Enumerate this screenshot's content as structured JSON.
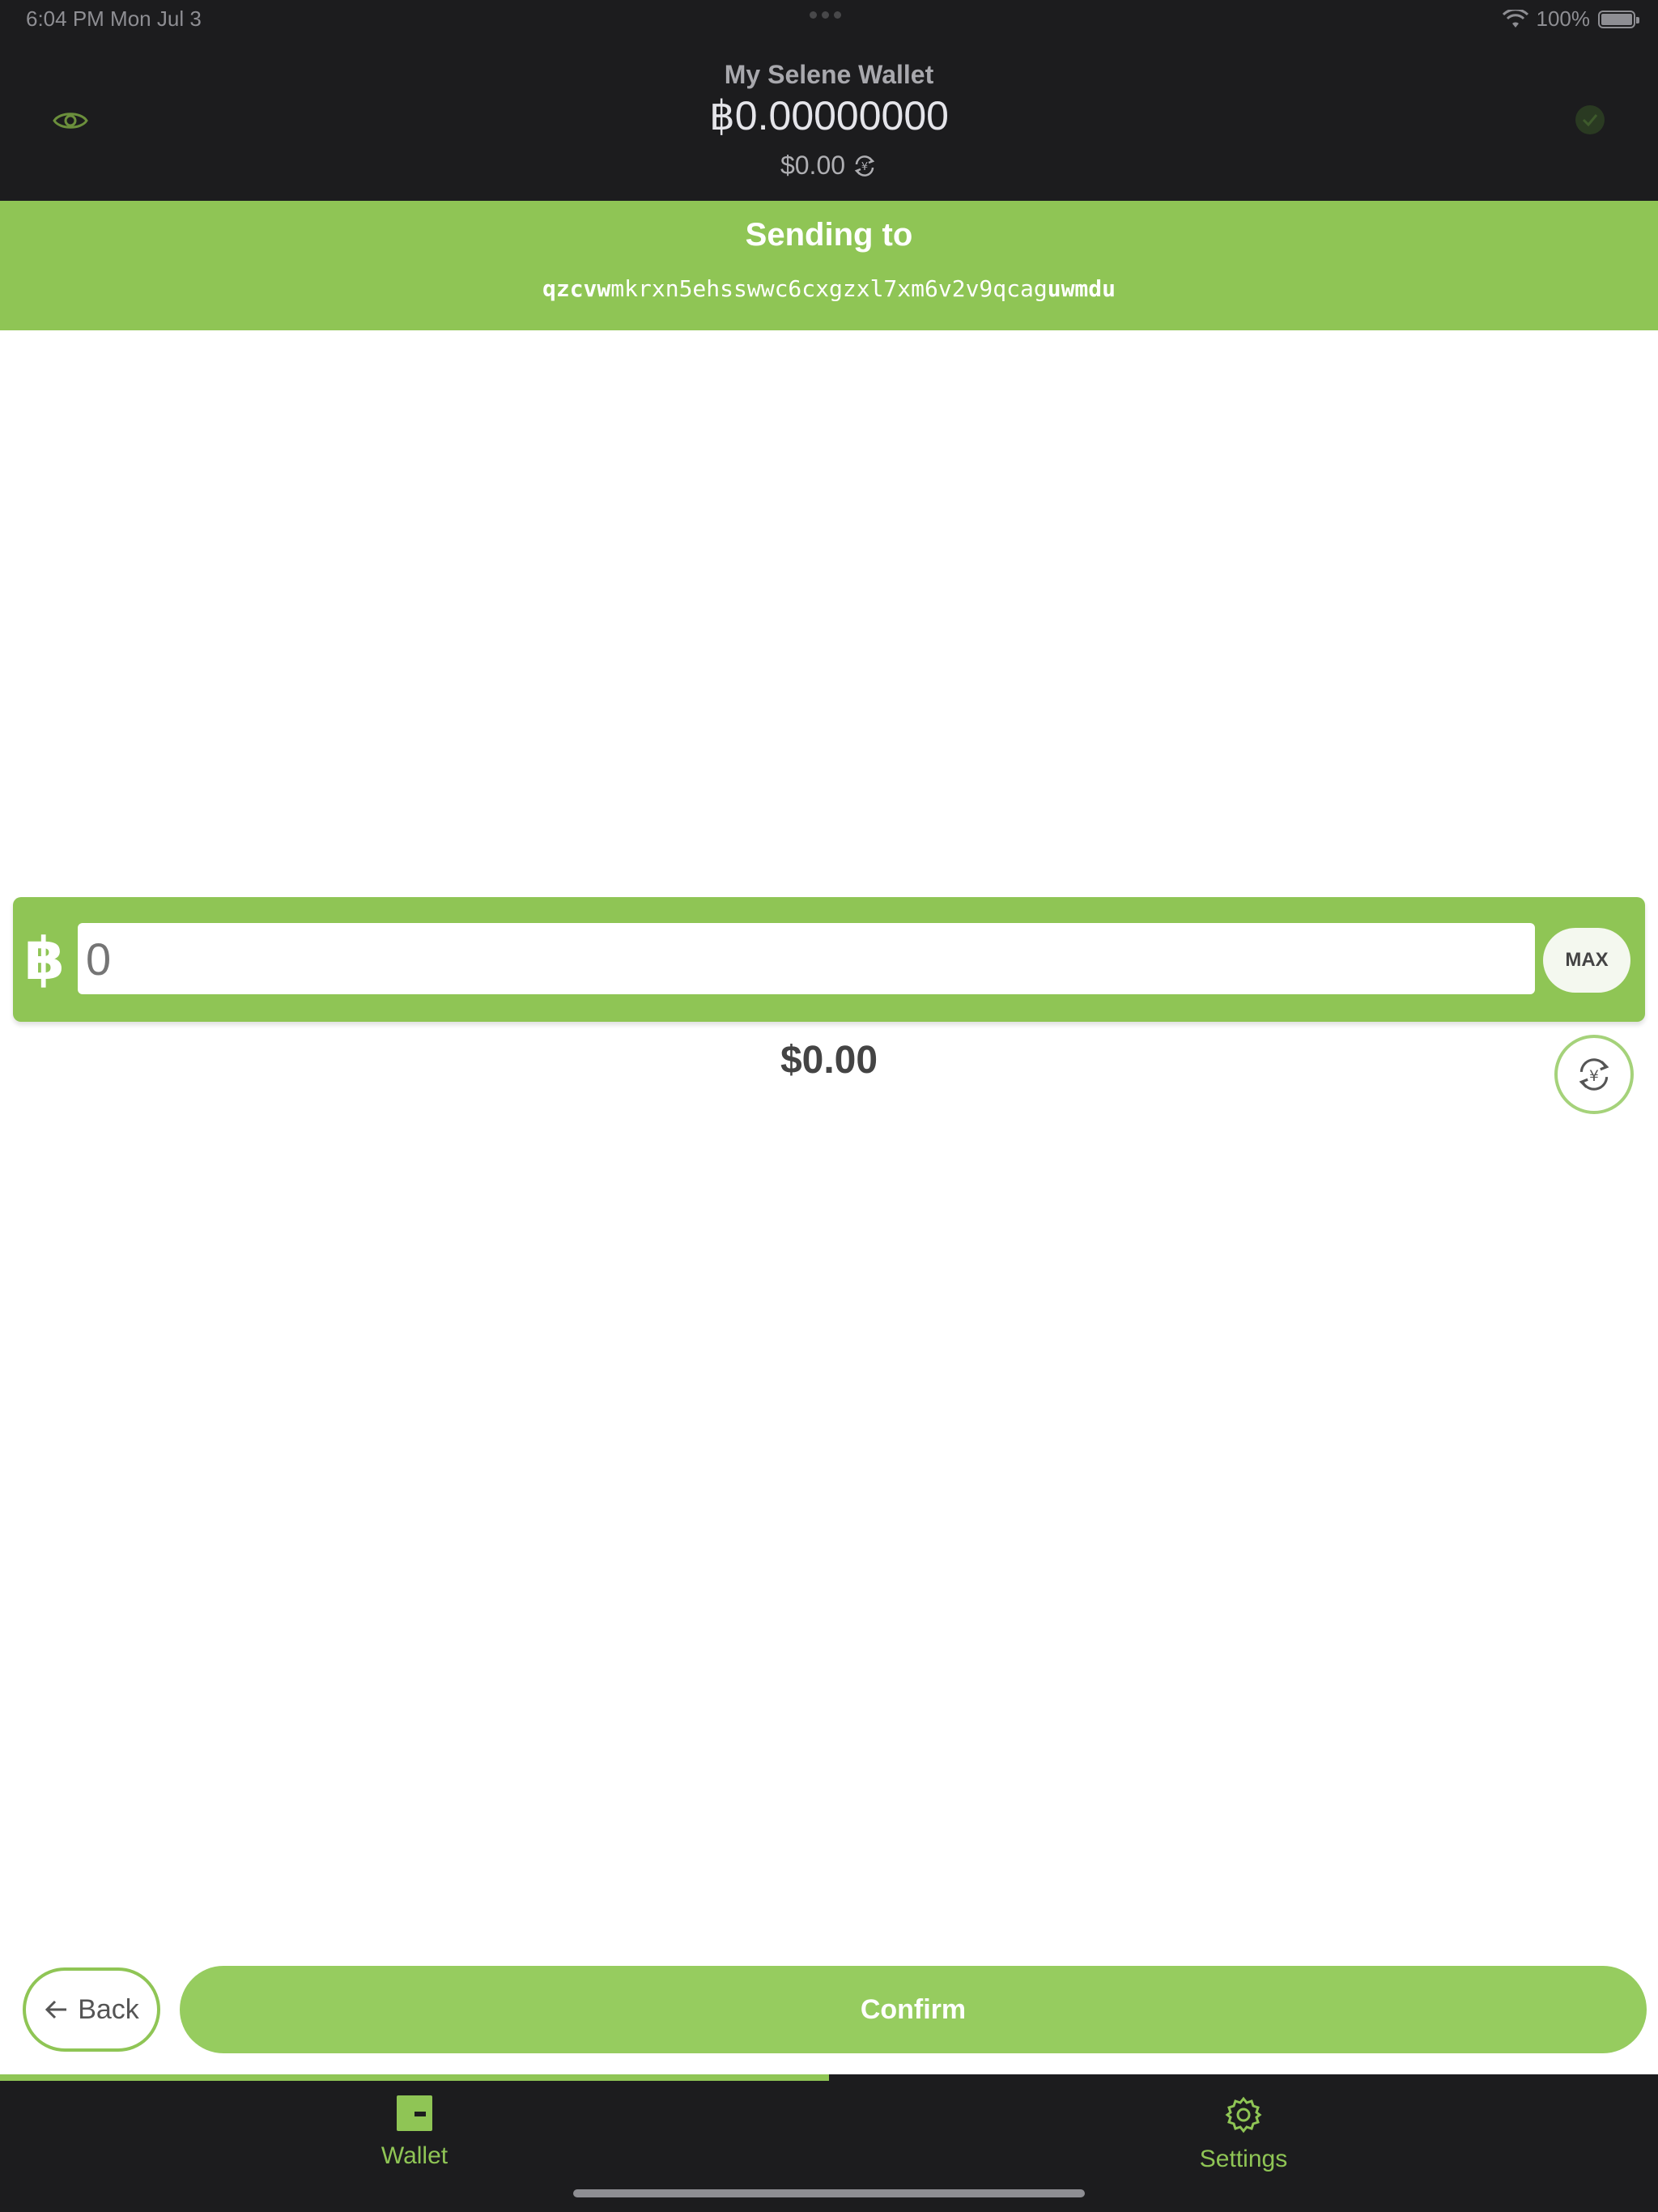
{
  "status_bar": {
    "time": "6:04 PM   Mon Jul 3",
    "battery": "100%"
  },
  "header": {
    "wallet_name": "My Selene Wallet",
    "balance_bch": "฿0.00000000",
    "balance_fiat": "$0.00"
  },
  "sending": {
    "title": "Sending to",
    "address_prefix": "qzcvw",
    "address_middle": "mkrxn5ehsswwc6cxgzxl7xm6v2v9qcag",
    "address_suffix": "uwmdu"
  },
  "amount": {
    "currency_symbol": "฿",
    "placeholder": "0",
    "max_label": "MAX",
    "fiat_value": "$0.00"
  },
  "actions": {
    "back_label": "Back",
    "confirm_label": "Confirm"
  },
  "progress": {
    "fraction": 0.5
  },
  "tabs": [
    {
      "label": "Wallet",
      "icon": "wallet-icon"
    },
    {
      "label": "Settings",
      "icon": "gear-icon"
    }
  ],
  "colors": {
    "accent": "#8fc555",
    "dark_bg": "#1c1c1e"
  }
}
